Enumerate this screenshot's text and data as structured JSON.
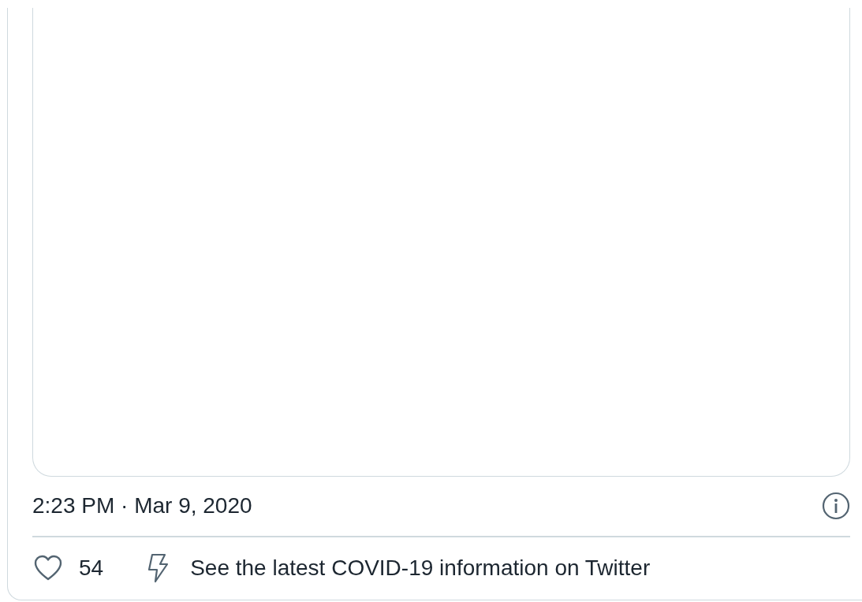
{
  "tweet": {
    "timestamp": "2:23 PM · Mar 9, 2020",
    "likes": "54",
    "info_link": "See the latest COVID-19 information on Twitter"
  }
}
